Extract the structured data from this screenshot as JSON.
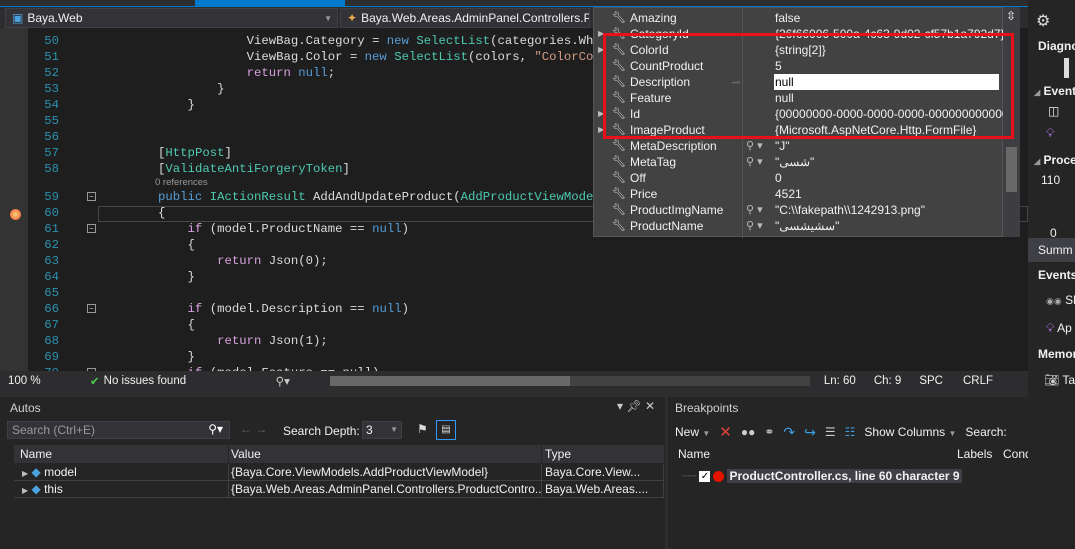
{
  "nav": {
    "project": "Baya.Web",
    "class": "Baya.Web.Areas.AdminPanel.Controllers.Pro"
  },
  "editor": {
    "lines": [
      {
        "n": "50",
        "fold": false,
        "t": [
          [
            "pl",
            "                    ViewBag.Category = "
          ],
          [
            "kw",
            "new "
          ],
          [
            "ty",
            "SelectList"
          ],
          [
            "pl",
            "(categories.Where(c =>"
          ]
        ]
      },
      {
        "n": "51",
        "fold": false,
        "t": [
          [
            "pl",
            "                    ViewBag.Color = "
          ],
          [
            "kw",
            "new "
          ],
          [
            "ty",
            "SelectList"
          ],
          [
            "pl",
            "(colors, "
          ],
          [
            "st",
            "\"ColorCode\""
          ],
          [
            "pl",
            ", "
          ],
          [
            "st",
            "\"Co"
          ]
        ]
      },
      {
        "n": "52",
        "fold": false,
        "t": [
          [
            "pl",
            "                    "
          ],
          [
            "ct",
            "return "
          ],
          [
            "kw",
            "null"
          ],
          [
            "pl",
            ";"
          ]
        ]
      },
      {
        "n": "53",
        "fold": false,
        "t": [
          [
            "pl",
            "                }"
          ]
        ]
      },
      {
        "n": "54",
        "fold": false,
        "t": [
          [
            "pl",
            "            }"
          ]
        ]
      },
      {
        "n": "55",
        "fold": false,
        "t": []
      },
      {
        "n": "56",
        "fold": false,
        "t": []
      },
      {
        "n": "57",
        "fold": false,
        "t": [
          [
            "pl",
            "        ["
          ],
          [
            "ty",
            "HttpPost"
          ],
          [
            "pl",
            "]"
          ]
        ]
      },
      {
        "n": "58",
        "fold": false,
        "t": [
          [
            "pl",
            "        ["
          ],
          [
            "ty",
            "ValidateAntiForgeryToken"
          ],
          [
            "pl",
            "]"
          ]
        ]
      },
      {
        "n": "59",
        "fold": true,
        "t": [
          [
            "kw",
            "        public "
          ],
          [
            "ty",
            "IActionResult "
          ],
          [
            "pl",
            "AddAndUpdateProduct("
          ],
          [
            "ty",
            "AddProductViewModel "
          ],
          [
            "pl",
            "mo"
          ]
        ]
      },
      {
        "n": "60",
        "fold": false,
        "t": [
          [
            "pl",
            "        {"
          ]
        ]
      },
      {
        "n": "61",
        "fold": true,
        "t": [
          [
            "ct",
            "            if "
          ],
          [
            "pl",
            "(model.ProductName == "
          ],
          [
            "kw",
            "null"
          ],
          [
            "pl",
            ")"
          ]
        ]
      },
      {
        "n": "62",
        "fold": false,
        "t": [
          [
            "pl",
            "            {"
          ]
        ]
      },
      {
        "n": "63",
        "fold": false,
        "t": [
          [
            "ct",
            "                return "
          ],
          [
            "pl",
            "Json(0);"
          ]
        ]
      },
      {
        "n": "64",
        "fold": false,
        "t": [
          [
            "pl",
            "            }"
          ]
        ]
      },
      {
        "n": "65",
        "fold": false,
        "t": []
      },
      {
        "n": "66",
        "fold": true,
        "t": [
          [
            "ct",
            "            if "
          ],
          [
            "pl",
            "(model.Description == "
          ],
          [
            "kw",
            "null"
          ],
          [
            "pl",
            ")"
          ]
        ]
      },
      {
        "n": "67",
        "fold": false,
        "t": [
          [
            "pl",
            "            {"
          ]
        ]
      },
      {
        "n": "68",
        "fold": false,
        "t": [
          [
            "ct",
            "                return "
          ],
          [
            "pl",
            "Json(1);"
          ]
        ]
      },
      {
        "n": "69",
        "fold": false,
        "t": [
          [
            "pl",
            "            }"
          ]
        ]
      },
      {
        "n": "70",
        "fold": true,
        "t": [
          [
            "ct",
            "            if "
          ],
          [
            "pl",
            "(model.Feature == null)"
          ]
        ]
      }
    ],
    "codelens": "0 references"
  },
  "datatip": {
    "rows": [
      {
        "name": "Amazing",
        "value": "false",
        "expand": false,
        "mag": false
      },
      {
        "name": "CategoryId",
        "value": "{26f66006-500a-4c63-9d02-cf57b1a792d7}",
        "expand": true,
        "mag": false
      },
      {
        "name": "ColorId",
        "value": "{string[2]}",
        "expand": true,
        "mag": false
      },
      {
        "name": "CountProduct",
        "value": "5",
        "expand": false,
        "mag": false
      },
      {
        "name": "Description",
        "value": "null",
        "expand": false,
        "mag": false,
        "highlight": true
      },
      {
        "name": "Feature",
        "value": "null",
        "expand": false,
        "mag": false
      },
      {
        "name": "Id",
        "value": "{00000000-0000-0000-0000-000000000000}",
        "expand": true,
        "mag": false
      },
      {
        "name": "ImageProduct",
        "value": "{Microsoft.AspNetCore.Http.FormFile}",
        "expand": true,
        "mag": false
      },
      {
        "name": "MetaDescription",
        "value": "\"J\"",
        "expand": false,
        "mag": true
      },
      {
        "name": "MetaTag",
        "value": "\"شسی\"",
        "expand": false,
        "mag": true
      },
      {
        "name": "Off",
        "value": "0",
        "expand": false,
        "mag": false
      },
      {
        "name": "Price",
        "value": "4521",
        "expand": false,
        "mag": false
      },
      {
        "name": "ProductImgName",
        "value": "\"C:\\\\fakepath\\\\1242913.png\"",
        "expand": false,
        "mag": true
      },
      {
        "name": "ProductName",
        "value": "\"سشیشسی\"",
        "expand": false,
        "mag": true
      }
    ],
    "highlight_color": "#e8101a"
  },
  "status": {
    "zoom": "100 %",
    "issues": "No issues found",
    "ln": "Ln: 60",
    "ch": "Ch: 9",
    "spc": "SPC",
    "crlf": "CRLF"
  },
  "autos": {
    "title": "Autos",
    "search_placeholder": "Search (Ctrl+E)",
    "depth_label": "Search Depth:",
    "depth": "3",
    "columns": [
      "Name",
      "Value",
      "Type"
    ],
    "rows": [
      {
        "name": "model",
        "value": "{Baya.Core.ViewModels.AddProductViewModel}",
        "type": "Baya.Core.View..."
      },
      {
        "name": "this",
        "value": "{Baya.Web.Areas.AdminPanel.Controllers.ProductContro...",
        "type": "Baya.Web.Areas...."
      }
    ]
  },
  "breakpoints": {
    "title": "Breakpoints",
    "new": "New",
    "show_columns": "Show Columns",
    "search": "Search:",
    "columns": [
      "Name",
      "Labels",
      "Condition",
      "H"
    ],
    "rows": [
      {
        "name": "ProductController.cs, line 60 character 9",
        "extra": "b"
      }
    ]
  },
  "diag": {
    "title": "Diagnostic",
    "tab": "Diagno",
    "events": "Events",
    "process": "Proce",
    "y_max": "110",
    "y_min": "0",
    "summary": "Summ",
    "events2": "Events",
    "item1": "Sh",
    "item2": "Ap",
    "memory": "Memor",
    "take": "Ta"
  }
}
